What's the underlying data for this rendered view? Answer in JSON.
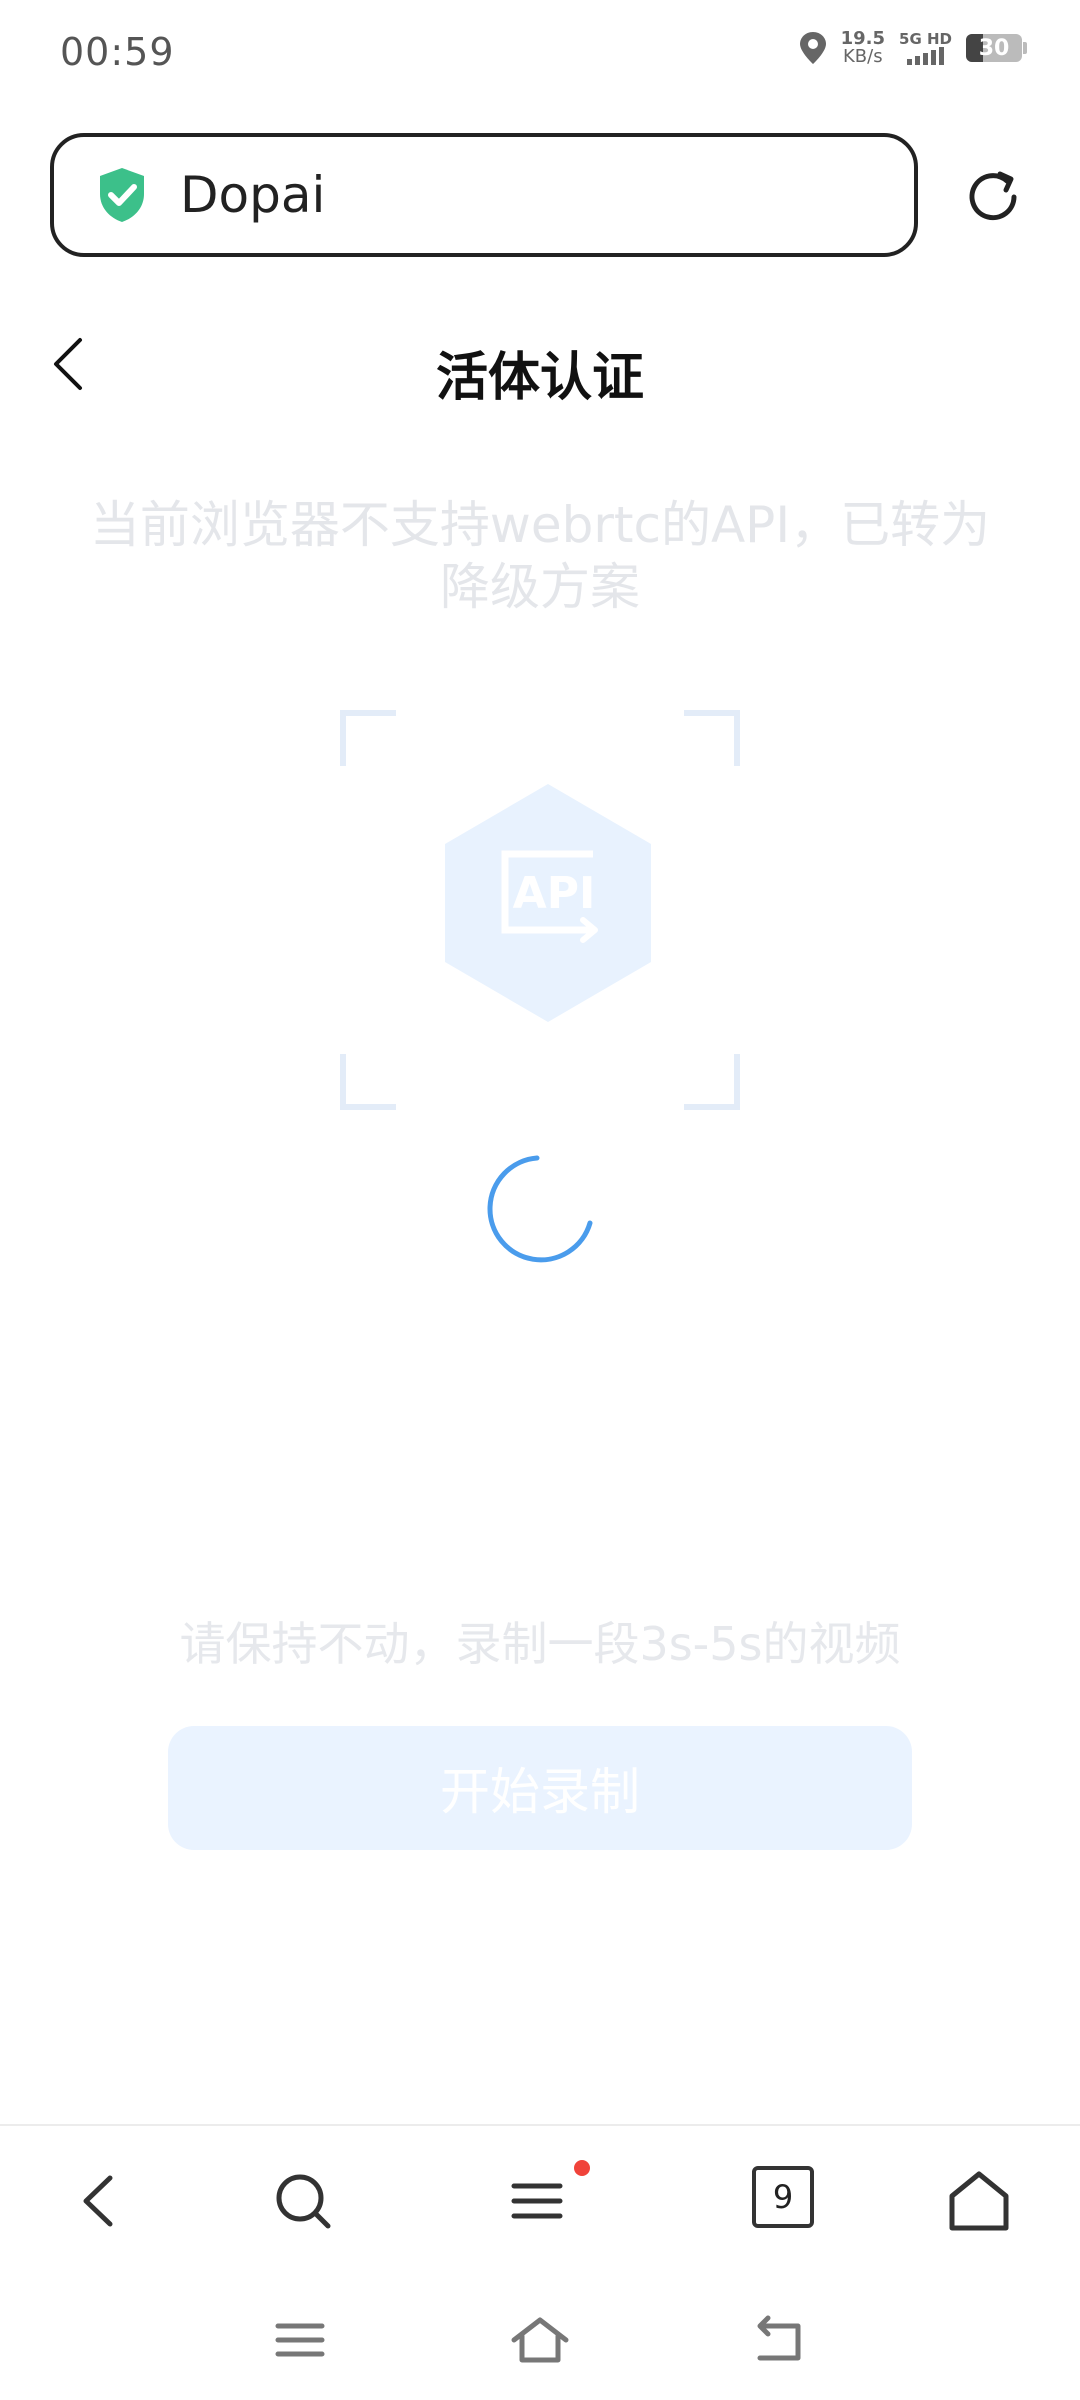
{
  "status_bar": {
    "time": "00:59",
    "net_speed_value": "19.5",
    "net_speed_unit": "KB/s",
    "signal_label": "5G HD",
    "battery": "30"
  },
  "browser": {
    "address_text": "Dopai",
    "tab_count": "9"
  },
  "page": {
    "title": "活体认证",
    "notice": "当前浏览器不支持webrtc的API，已转为降级方案",
    "api_label": "API",
    "hint": "请保持不动，录制一段3s-5s的视频",
    "record_button": "开始录制"
  },
  "colors": {
    "accent": "#4a9cec",
    "shield": "#3cc08a",
    "badge": "#f0433a"
  }
}
